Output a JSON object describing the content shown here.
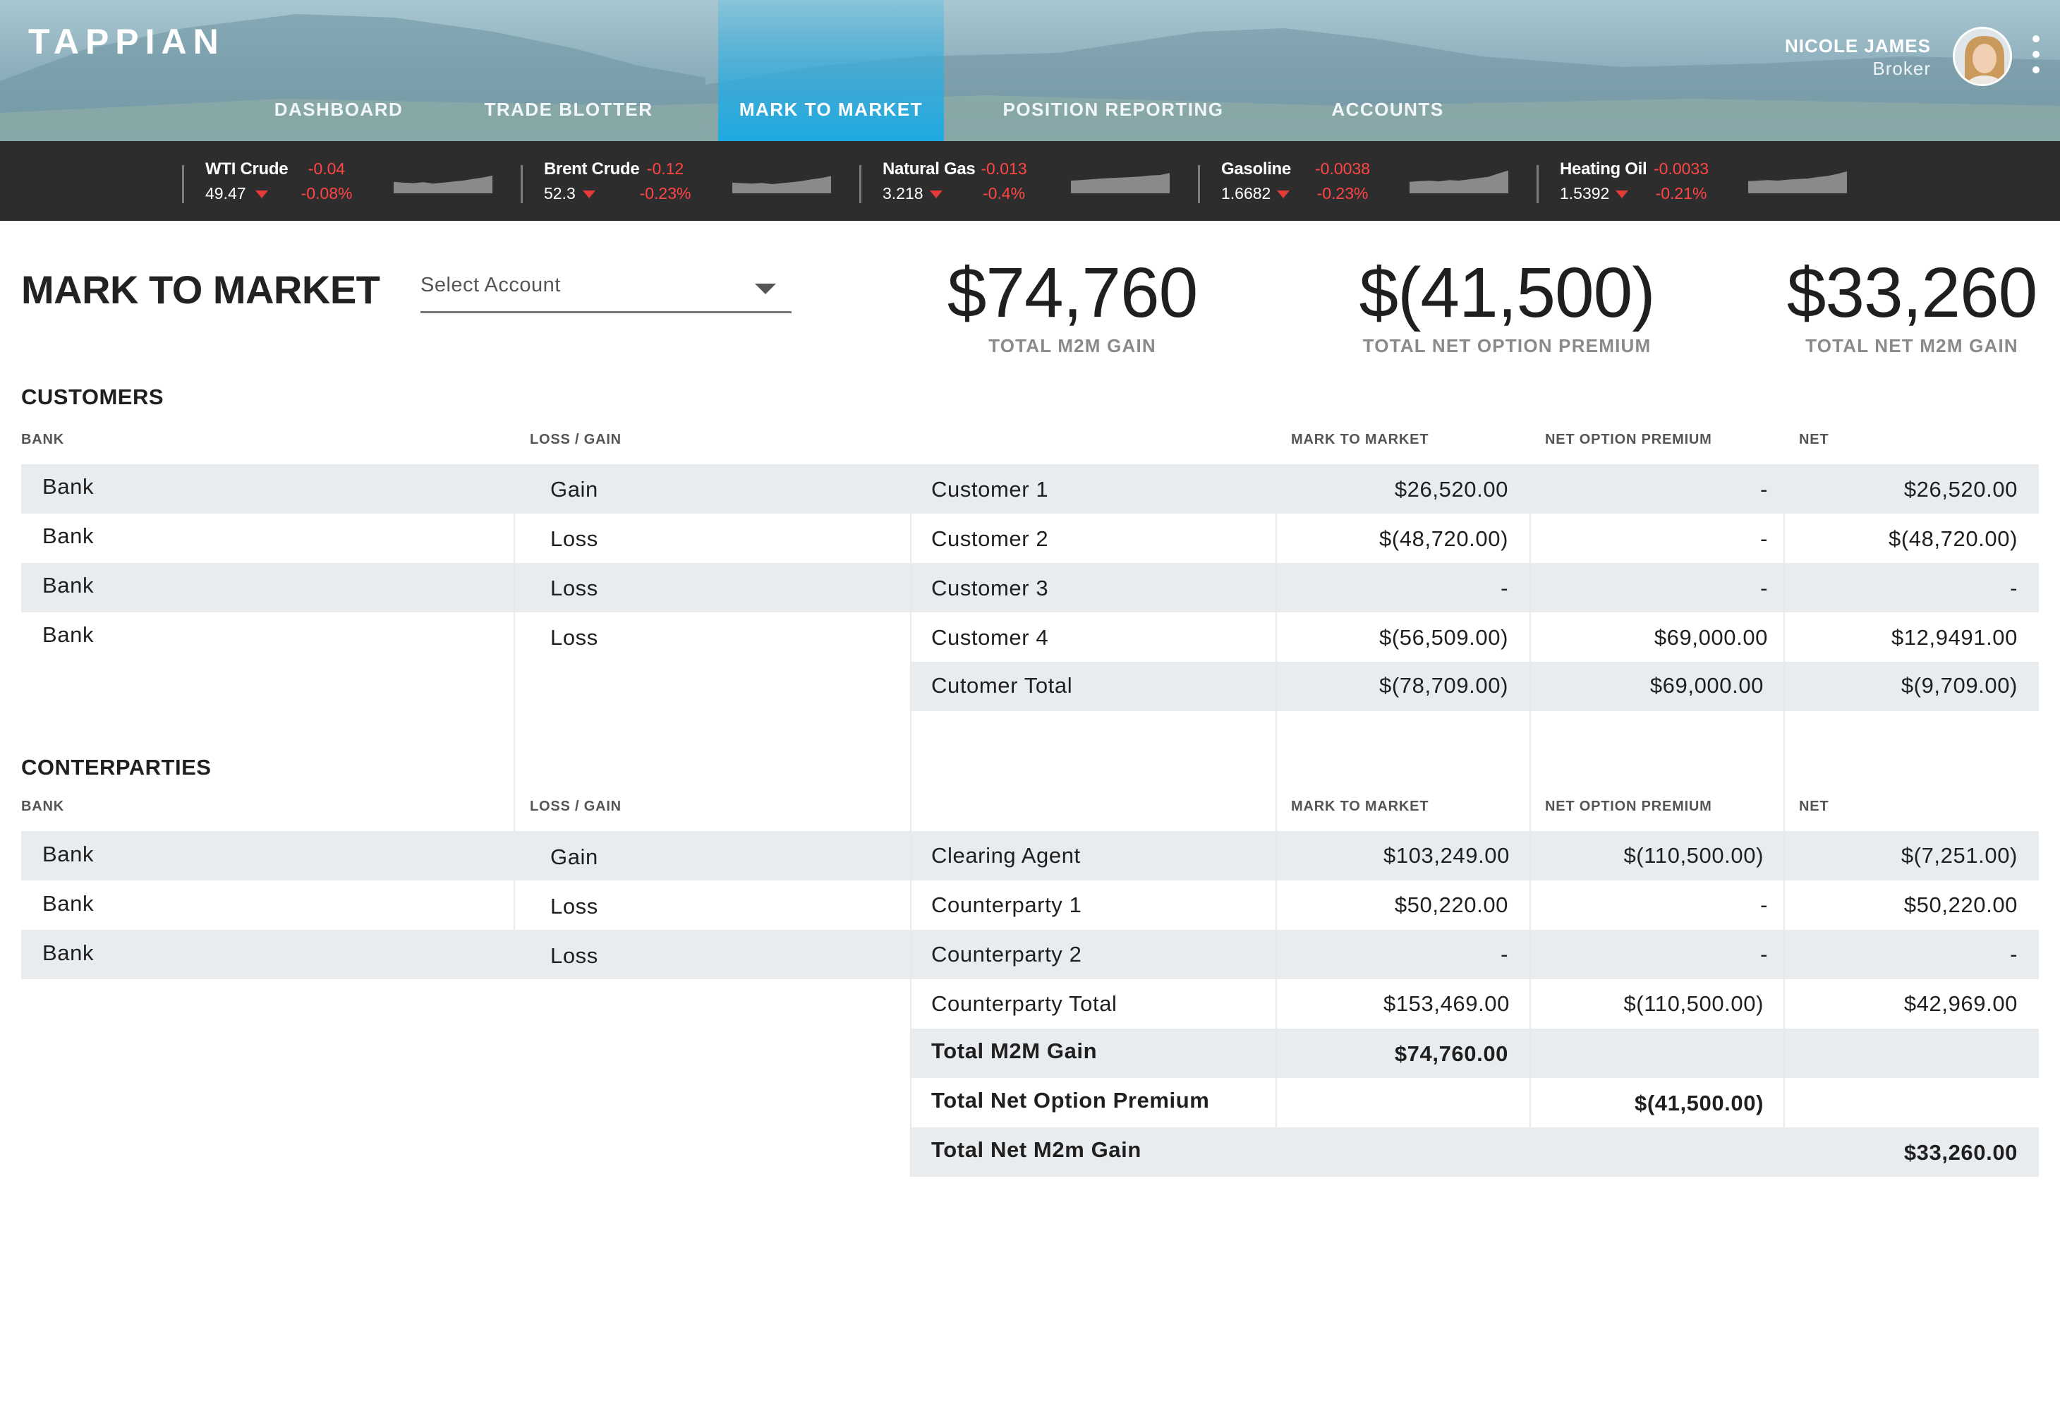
{
  "app": {
    "logo": "TAPPIAN"
  },
  "nav": {
    "items": [
      {
        "label": "DASHBOARD",
        "active": false
      },
      {
        "label": "TRADE BLOTTER",
        "active": false
      },
      {
        "label": "MARK TO MARKET",
        "active": true
      },
      {
        "label": "POSITION REPORTING",
        "active": false
      },
      {
        "label": "ACCOUNTS",
        "active": false
      }
    ]
  },
  "user": {
    "name": "NICOLE JAMES",
    "role": "Broker"
  },
  "ticker": [
    {
      "name": "WTI Crude",
      "price": "49.47",
      "change": "-0.04",
      "percent": "-0.08%",
      "direction": "down",
      "spark": [
        0.45,
        0.42,
        0.4,
        0.44,
        0.38,
        0.42,
        0.46,
        0.5,
        0.56,
        0.62,
        0.7
      ]
    },
    {
      "name": "Brent Crude",
      "price": "52.3",
      "change": "-0.12",
      "percent": "-0.23%",
      "direction": "down",
      "spark": [
        0.42,
        0.4,
        0.38,
        0.41,
        0.36,
        0.4,
        0.44,
        0.48,
        0.55,
        0.6,
        0.68
      ]
    },
    {
      "name": "Natural Gas",
      "price": "3.218",
      "change": "-0.013",
      "percent": "-0.4%",
      "direction": "down",
      "spark": [
        0.5,
        0.52,
        0.55,
        0.58,
        0.6,
        0.62,
        0.64,
        0.66,
        0.7,
        0.72,
        0.8
      ]
    },
    {
      "name": "Gasoline",
      "price": "1.6682",
      "change": "-0.0038",
      "percent": "-0.23%",
      "direction": "down",
      "spark": [
        0.45,
        0.48,
        0.5,
        0.47,
        0.52,
        0.5,
        0.55,
        0.6,
        0.65,
        0.78,
        0.9
      ]
    },
    {
      "name": "Heating Oil",
      "price": "1.5392",
      "change": "-0.0033",
      "percent": "-0.21%",
      "direction": "down",
      "spark": [
        0.48,
        0.5,
        0.52,
        0.5,
        0.54,
        0.56,
        0.58,
        0.64,
        0.68,
        0.76,
        0.86
      ]
    }
  ],
  "page": {
    "title": "MARK TO MARKET",
    "select_placeholder": "Select Account"
  },
  "summary": [
    {
      "value": "$74,760",
      "label": "TOTAL M2M GAIN"
    },
    {
      "value": "$(41,500)",
      "label": "TOTAL NET OPTION PREMIUM"
    },
    {
      "value": "$33,260",
      "label": "TOTAL NET M2M GAIN"
    }
  ],
  "customers": {
    "title": "CUSTOMERS",
    "headers": {
      "bank": "BANK",
      "loss_gain": "LOSS / GAIN",
      "m2m": "MARK TO MARKET",
      "nop": "NET OPTION PREMIUM",
      "net": "NET"
    },
    "rows": [
      {
        "bank": "Bank",
        "type": "Gain",
        "name": "Customer 1",
        "m2m": "$26,520.00",
        "nop": "-",
        "net": "$26,520.00"
      },
      {
        "bank": "Bank",
        "type": "Loss",
        "name": "Customer 2",
        "m2m": "$(48,720.00)",
        "nop": "-",
        "net": "$(48,720.00)"
      },
      {
        "bank": "Bank",
        "type": "Loss",
        "name": "Customer 3",
        "m2m": "-",
        "nop": "-",
        "net": "-"
      },
      {
        "bank": "Bank",
        "type": "Loss",
        "name": "Customer 4",
        "m2m": "$(56,509.00)",
        "nop": "$69,000.00",
        "net": "$12,9491.00"
      }
    ],
    "total": {
      "name": "Cutomer Total",
      "m2m": "$(78,709.00)",
      "nop": "$69,000.00",
      "net": "$(9,709.00)"
    }
  },
  "counterparties": {
    "title": "CONTERPARTIES",
    "headers": {
      "bank": "BANK",
      "loss_gain": "LOSS / GAIN",
      "m2m": "MARK TO MARKET",
      "nop": "NET OPTION PREMIUM",
      "net": "NET"
    },
    "rows": [
      {
        "bank": "Bank",
        "type": "Gain",
        "name": "Clearing Agent",
        "m2m": "$103,249.00",
        "nop": "$(110,500.00)",
        "net": "$(7,251.00)"
      },
      {
        "bank": "Bank",
        "type": "Loss",
        "name": "Counterparty 1",
        "m2m": "$50,220.00",
        "nop": "-",
        "net": "$50,220.00"
      },
      {
        "bank": "Bank",
        "type": "Loss",
        "name": "Counterparty 2",
        "m2m": "-",
        "nop": "-",
        "net": "-"
      }
    ],
    "total": {
      "name": "Counterparty Total",
      "m2m": "$153,469.00",
      "nop": "$(110,500.00)",
      "net": "$42,969.00"
    }
  },
  "totals": [
    {
      "label": "Total M2M Gain",
      "value": "$74,760.00",
      "column": "m2m"
    },
    {
      "label": "Total Net Option Premium",
      "value": "$(41,500.00)",
      "column": "nop"
    },
    {
      "label": "Total Net M2m Gain",
      "value": "$33,260.00",
      "column": "net"
    }
  ],
  "colors": {
    "accent": "#1ea9e2",
    "ticker_bg": "#2d2d2d",
    "negative": "#ff4545",
    "row_stripe": "#e9ecef"
  }
}
